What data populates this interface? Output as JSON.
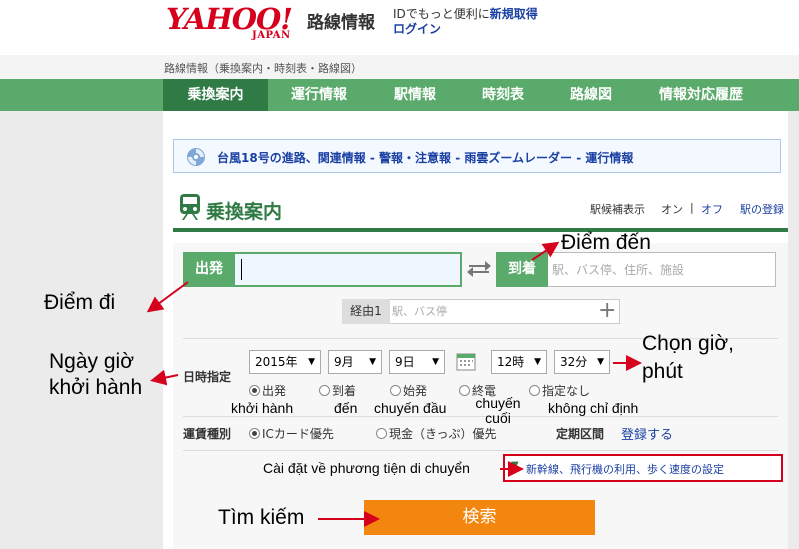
{
  "header": {
    "logo_main": "YAHOO!",
    "logo_sub": "JAPAN",
    "service": "路線情報",
    "id_text": "IDでもっと便利に",
    "id_link": "新規取得",
    "login": "ログイン"
  },
  "breadcrumb": "路線情報（乗換案内・時刻表・路線図）",
  "nav": [
    {
      "label": "乗換案内"
    },
    {
      "label": "運行情報"
    },
    {
      "label": "駅情報"
    },
    {
      "label": "時刻表"
    },
    {
      "label": "路線図"
    },
    {
      "label": "情報対応履歴"
    }
  ],
  "notice": "台風18号の進路、関連情報 - 警報・注意報 - 雨雲ズームレーダー - 運行情報",
  "section": {
    "title": "乗換案内",
    "station_complete": "駅候補表示",
    "on": "オン",
    "sep": "|",
    "off": "オフ",
    "register": "駅の登録"
  },
  "form": {
    "departure_label": "出発",
    "departure_value": "",
    "arrival_label": "到着",
    "arrival_placeholder": "駅、バス停、住所、施設",
    "via_label": "経由1",
    "via_placeholder": "駅、バス停",
    "via_add": "+",
    "datetime_label": "日時指定",
    "year": "2015年",
    "month": "9月",
    "day": "9日",
    "hour": "12時",
    "minute": "32分",
    "time_options": [
      "出発",
      "到着",
      "始発",
      "終電",
      "指定なし"
    ],
    "fare_label": "運賃種別",
    "fare_options": [
      "ICカード優先",
      "現金（きっぷ）優先"
    ],
    "teiki_label": "定期区間",
    "teiki_link": "登録する",
    "settings_link": "新幹線、飛行機の利用、歩く速度の設定",
    "search_button": "検索"
  },
  "annotations": {
    "destination": "Điểm đến",
    "origin": "Điểm đi",
    "depart_time": "Ngày giờ khởi hành",
    "choose_time": "Chọn giờ, phút",
    "opt_depart": "khởi hành",
    "opt_arrive": "đến",
    "opt_first": "chuyến đầu",
    "opt_last": "chuyến cuối",
    "opt_none": "không chỉ định",
    "transport": "Cài đặt về phương tiện di chuyển",
    "search": "Tìm kiếm"
  },
  "colors": {
    "nav_green": "#5aaa6b",
    "dark_green": "#2f7a45",
    "yahoo_red": "#d6001c",
    "search_orange": "#f3860f",
    "link_blue": "#1a3fa3"
  }
}
